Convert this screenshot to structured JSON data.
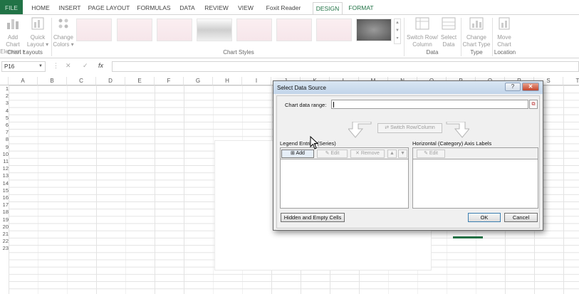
{
  "ribbon_tabs": [
    {
      "label": "FILE"
    },
    {
      "label": "HOME"
    },
    {
      "label": "INSERT"
    },
    {
      "label": "PAGE LAYOUT"
    },
    {
      "label": "FORMULAS"
    },
    {
      "label": "DATA"
    },
    {
      "label": "REVIEW"
    },
    {
      "label": "VIEW"
    },
    {
      "label": "Foxit Reader PDF"
    },
    {
      "label": "DESIGN"
    },
    {
      "label": "FORMAT"
    }
  ],
  "active_tab": "DESIGN",
  "ribbon": {
    "add_chart_element": {
      "line1": "Add Chart",
      "line2": "Element ▾"
    },
    "quick_layout": {
      "line1": "Quick",
      "line2": "Layout ▾"
    },
    "change_colors": {
      "line1": "Change",
      "line2": "Colors ▾"
    },
    "switch_row_column": {
      "line1": "Switch Row/",
      "line2": "Column"
    },
    "select_data": {
      "line1": "Select",
      "line2": "Data"
    },
    "change_chart_type": {
      "line1": "Change",
      "line2": "Chart Type"
    },
    "move_chart": {
      "line1": "Move",
      "line2": "Chart"
    },
    "groups": {
      "chart_layouts": "Chart Layouts",
      "chart_styles": "Chart Styles",
      "data": "Data",
      "type": "Type",
      "location": "Location"
    }
  },
  "formula_bar": {
    "name_box": "P16",
    "fx": "fx",
    "cancel": "✕",
    "enter": "✓",
    "formula": ""
  },
  "columns": [
    "A",
    "B",
    "C",
    "D",
    "E",
    "F",
    "G",
    "H",
    "I",
    "J",
    "K",
    "L",
    "M",
    "N",
    "O",
    "P",
    "Q",
    "R",
    "S",
    "T"
  ],
  "rows": [
    "1",
    "2",
    "3",
    "4",
    "5",
    "6",
    "7",
    "8",
    "9",
    "10",
    "11",
    "12",
    "13",
    "14",
    "15",
    "16",
    "17",
    "18",
    "19",
    "20",
    "21",
    "22",
    "23"
  ],
  "dialog": {
    "title": "Select Data Source",
    "help": "?",
    "close": "✕",
    "chart_data_range_label": "Chart data range:",
    "chart_data_range_value": "",
    "switch_row_column": "Switch Row/Column",
    "legend_entries_label": "Legend Entries (Series)",
    "axis_labels_label": "Horizontal (Category) Axis Labels",
    "add": "Add",
    "edit": "Edit",
    "remove": "Remove",
    "axis_edit": "Edit",
    "hidden_empty_cells": "Hidden and Empty Cells",
    "ok": "OK",
    "cancel": "Cancel"
  },
  "colors": {
    "excel_green": "#217346",
    "dialog_bg": "#f0f0f0",
    "close_red": "#c5452b"
  },
  "icons": [
    "chart-element-icon",
    "quick-layout-icon",
    "change-colors-icon",
    "switch-row-column-icon",
    "select-data-icon",
    "change-chart-type-icon",
    "move-chart-icon",
    "collapse-dialog-icon",
    "mouse-cursor-icon"
  ]
}
